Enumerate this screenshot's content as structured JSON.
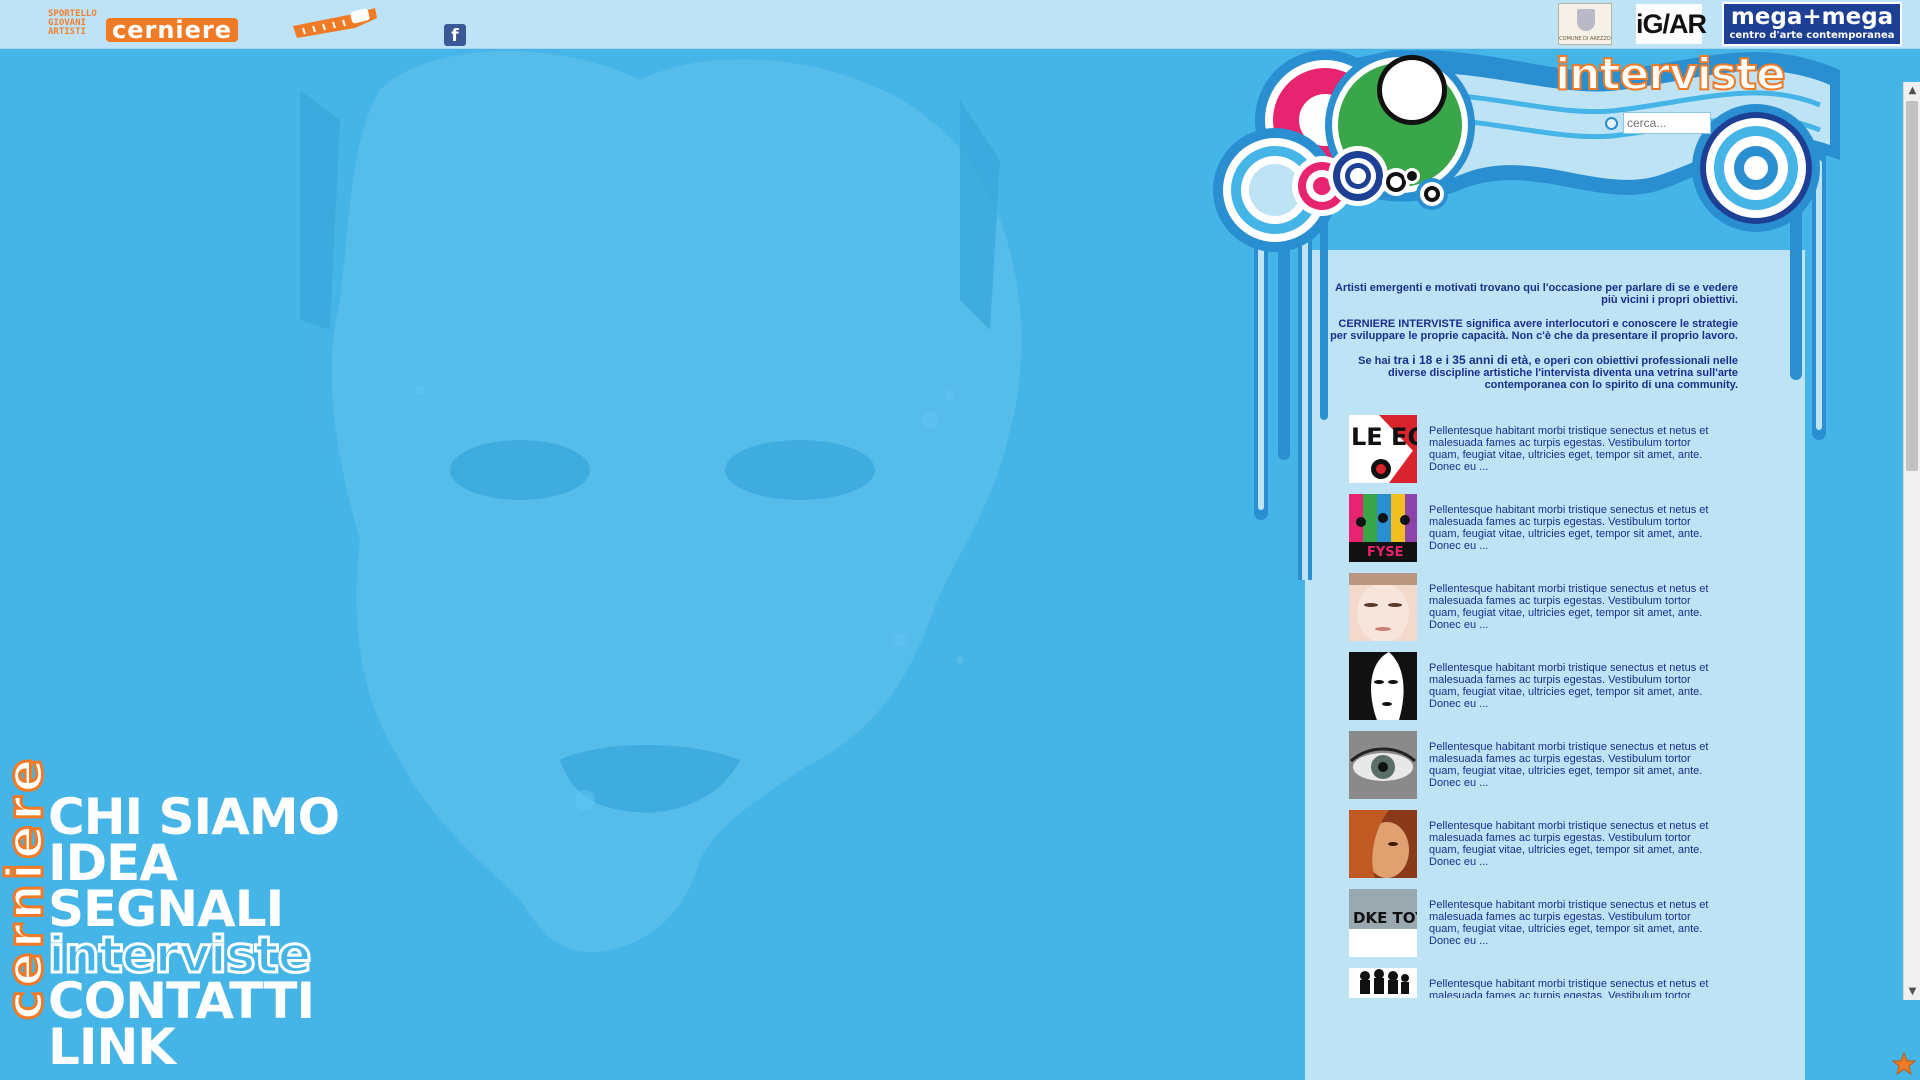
{
  "brand": {
    "small_lines": [
      "SPORTELLO",
      "GIOVANI",
      "ARTISTI"
    ],
    "name": "cerniere"
  },
  "social": {
    "facebook_glyph": "f"
  },
  "sponsors": {
    "comune": "COMUNE DI AREZZO",
    "igar": "iG/AR",
    "mega_title": "mega+mega",
    "mega_subtitle": "centro d'arte contemporanea"
  },
  "vertical_logo": "cerniere",
  "nav": {
    "items": [
      "CHI SIAMO",
      "IDEA",
      "SEGNALI",
      "interviste",
      "CONTATTI",
      "LINK"
    ]
  },
  "section": {
    "title": "interviste"
  },
  "search": {
    "placeholder": "cerca..."
  },
  "intro": {
    "p1": "Artisti emergenti e motivati trovano qui l'occasione per parlare di se e vedere più vicini i propri obiettivi.",
    "p2": "CERNIERE INTERVISTE significa avere interlocutori e conoscere le strategie per sviluppare le proprie capacità. Non c'è che da presentare il proprio lavoro.",
    "p3_pre": "Se hai ",
    "p3_strong": "tra i 18 e i 35 anni di età",
    "p3_post": ", e operi con obiettivi professionali nelle diverse discipline artistiche l'intervista diventa una vetrina sull'arte contemporanea con lo spirito di una community."
  },
  "interviews": [
    {
      "excerpt": "Pellentesque habitant morbi tristique senectus et netus et malesuada fames ac turpis egestas. Vestibulum tortor quam, feugiat vitae, ultricies eget, tempor sit amet, ante. Donec eu ...",
      "thumb_text": "LE EO"
    },
    {
      "excerpt": "Pellentesque habitant morbi tristique senectus et netus et malesuada fames ac turpis egestas. Vestibulum tortor quam, feugiat vitae, ultricies eget, tempor sit amet, ante. Donec eu ...",
      "thumb_text": "FYSE"
    },
    {
      "excerpt": "Pellentesque habitant morbi tristique senectus et netus et malesuada fames ac turpis egestas. Vestibulum tortor quam, feugiat vitae, ultricies eget, tempor sit amet, ante. Donec eu ...",
      "thumb_text": ""
    },
    {
      "excerpt": "Pellentesque habitant morbi tristique senectus et netus et malesuada fames ac turpis egestas. Vestibulum tortor quam, feugiat vitae, ultricies eget, tempor sit amet, ante. Donec eu ...",
      "thumb_text": ""
    },
    {
      "excerpt": "Pellentesque habitant morbi tristique senectus et netus et malesuada fames ac turpis egestas. Vestibulum tortor quam, feugiat vitae, ultricies eget, tempor sit amet, ante. Donec eu ...",
      "thumb_text": ""
    },
    {
      "excerpt": "Pellentesque habitant morbi tristique senectus et netus et malesuada fames ac turpis egestas. Vestibulum tortor quam, feugiat vitae, ultricies eget, tempor sit amet, ante. Donec eu ...",
      "thumb_text": ""
    },
    {
      "excerpt": "Pellentesque habitant morbi tristique senectus et netus et malesuada fames ac turpis egestas. Vestibulum tortor quam, feugiat vitae, ultricies eget, tempor sit amet, ante. Donec eu ...",
      "thumb_text": "DKE TOYS"
    },
    {
      "excerpt": "Pellentesque habitant morbi tristique senectus et netus et malesuada fames ac turpis egestas. Vestibulum tortor quam, feugiat vitae, ultricies eget, tempor sit amet, ante. Donec eu ...",
      "thumb_text": ""
    }
  ],
  "colors": {
    "background": "#45b4e6",
    "accent_orange": "#f07a25",
    "panel": "#bee3f5",
    "text_navy": "#1b2e8c"
  },
  "icons": [
    "facebook-icon",
    "search-icon",
    "star-icon",
    "scroll-up-icon",
    "scroll-down-icon"
  ]
}
